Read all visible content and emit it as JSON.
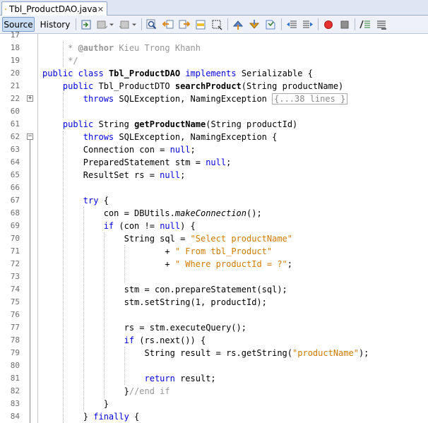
{
  "file_tab": {
    "name": "Tbl_ProductDAO.java",
    "close_icon": "close-icon"
  },
  "toolbar": {
    "source_label": "Source",
    "history_label": "History"
  },
  "lines": [
    {
      "n": "17",
      "tokens": []
    },
    {
      "n": "18",
      "tokens": [
        {
          "t": "     * ",
          "c": "cm"
        },
        {
          "t": "@author",
          "c": "cmtag"
        },
        {
          "t": " Kieu Trong Khanh",
          "c": "cm"
        }
      ]
    },
    {
      "n": "19",
      "tokens": [
        {
          "t": "     */",
          "c": "cm"
        }
      ]
    },
    {
      "n": "20",
      "tokens": [
        {
          "t": "public",
          "c": "kw"
        },
        {
          "t": " "
        },
        {
          "t": "class",
          "c": "kw"
        },
        {
          "t": " "
        },
        {
          "t": "Tbl_ProductDAO",
          "c": "bold"
        },
        {
          "t": " "
        },
        {
          "t": "implements",
          "c": "kw"
        },
        {
          "t": " Serializable {"
        }
      ]
    },
    {
      "n": "21",
      "tokens": [
        {
          "t": "    "
        },
        {
          "t": "public",
          "c": "kw"
        },
        {
          "t": " Tbl_ProductDTO "
        },
        {
          "t": "searchProduct",
          "c": "bold"
        },
        {
          "t": "(String productName)"
        }
      ]
    },
    {
      "n": "22",
      "fold": "+",
      "tokens": [
        {
          "t": "        "
        },
        {
          "t": "throws",
          "c": "kw"
        },
        {
          "t": " SQLException, NamingException "
        },
        {
          "t": "{...38 lines }",
          "c": "foldbox"
        }
      ]
    },
    {
      "n": "60",
      "tokens": []
    },
    {
      "n": "61",
      "tokens": [
        {
          "t": "    "
        },
        {
          "t": "public",
          "c": "kw"
        },
        {
          "t": " String "
        },
        {
          "t": "getProductName",
          "c": "bold"
        },
        {
          "t": "(String productId)"
        }
      ]
    },
    {
      "n": "62",
      "fold": "-",
      "tokens": [
        {
          "t": "        "
        },
        {
          "t": "throws",
          "c": "kw"
        },
        {
          "t": " SQLException, NamingException {"
        }
      ]
    },
    {
      "n": "63",
      "tokens": [
        {
          "t": "        Connection con = "
        },
        {
          "t": "null",
          "c": "kw"
        },
        {
          "t": ";"
        }
      ]
    },
    {
      "n": "64",
      "tokens": [
        {
          "t": "        PreparedStatement stm = "
        },
        {
          "t": "null",
          "c": "kw"
        },
        {
          "t": ";"
        }
      ]
    },
    {
      "n": "65",
      "tokens": [
        {
          "t": "        ResultSet rs = "
        },
        {
          "t": "null",
          "c": "kw"
        },
        {
          "t": ";"
        }
      ]
    },
    {
      "n": "66",
      "tokens": []
    },
    {
      "n": "67",
      "tokens": [
        {
          "t": "        "
        },
        {
          "t": "try",
          "c": "kw"
        },
        {
          "t": " {"
        }
      ]
    },
    {
      "n": "68",
      "tokens": [
        {
          "t": "            con = DBUtils."
        },
        {
          "t": "makeConnection",
          "c": "it"
        },
        {
          "t": "();"
        }
      ]
    },
    {
      "n": "69",
      "tokens": [
        {
          "t": "            "
        },
        {
          "t": "if",
          "c": "kw"
        },
        {
          "t": " (con != "
        },
        {
          "t": "null",
          "c": "kw"
        },
        {
          "t": ") {"
        }
      ]
    },
    {
      "n": "70",
      "tokens": [
        {
          "t": "                String sql = "
        },
        {
          "t": "\"Select productName\"",
          "c": "str"
        }
      ]
    },
    {
      "n": "71",
      "tokens": [
        {
          "t": "                        + "
        },
        {
          "t": "\" From tbl_Product\"",
          "c": "str"
        }
      ]
    },
    {
      "n": "72",
      "tokens": [
        {
          "t": "                        + "
        },
        {
          "t": "\" Where productId = ?\"",
          "c": "str"
        },
        {
          "t": ";"
        }
      ]
    },
    {
      "n": "73",
      "tokens": []
    },
    {
      "n": "74",
      "tokens": [
        {
          "t": "                stm = con.prepareStatement(sql);"
        }
      ]
    },
    {
      "n": "75",
      "tokens": [
        {
          "t": "                stm.setString(1, productId);"
        }
      ]
    },
    {
      "n": "76",
      "tokens": []
    },
    {
      "n": "77",
      "tokens": [
        {
          "t": "                rs = stm.executeQuery();"
        }
      ]
    },
    {
      "n": "78",
      "tokens": [
        {
          "t": "                "
        },
        {
          "t": "if",
          "c": "kw"
        },
        {
          "t": " (rs.next()) {"
        }
      ]
    },
    {
      "n": "79",
      "tokens": [
        {
          "t": "                    String result = rs.getString("
        },
        {
          "t": "\"productName\"",
          "c": "str"
        },
        {
          "t": ");"
        }
      ]
    },
    {
      "n": "80",
      "tokens": []
    },
    {
      "n": "81",
      "tokens": [
        {
          "t": "                    "
        },
        {
          "t": "return",
          "c": "kw"
        },
        {
          "t": " result;"
        }
      ]
    },
    {
      "n": "82",
      "tokens": [
        {
          "t": "                }"
        },
        {
          "t": "//end if",
          "c": "cm"
        }
      ]
    },
    {
      "n": "83",
      "tokens": [
        {
          "t": "            }"
        }
      ]
    },
    {
      "n": "84",
      "tokens": [
        {
          "t": "        } "
        },
        {
          "t": "finally",
          "c": "kw"
        },
        {
          "t": " {"
        }
      ]
    }
  ]
}
